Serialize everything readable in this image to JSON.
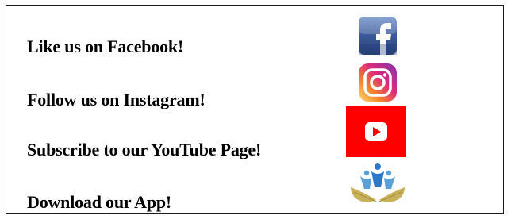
{
  "links": [
    {
      "label": "Like us on Facebook!",
      "icon": "facebook-icon"
    },
    {
      "label": "Follow us on Instagram!",
      "icon": "instagram-icon"
    },
    {
      "label": "Subscribe to our YouTube Page!",
      "icon": "youtube-icon"
    },
    {
      "label": "Download our App!",
      "icon": "app-logo-icon"
    }
  ],
  "colors": {
    "facebook_blue": "#3b5998",
    "youtube_red": "#ff0000",
    "instagram_orange": "#f58529",
    "instagram_pink": "#dd2a7b",
    "instagram_purple": "#8134af",
    "app_blue": "#2d79c7",
    "app_gold": "#c8b15a",
    "text": "#000000",
    "border": "#1a1a1a"
  }
}
